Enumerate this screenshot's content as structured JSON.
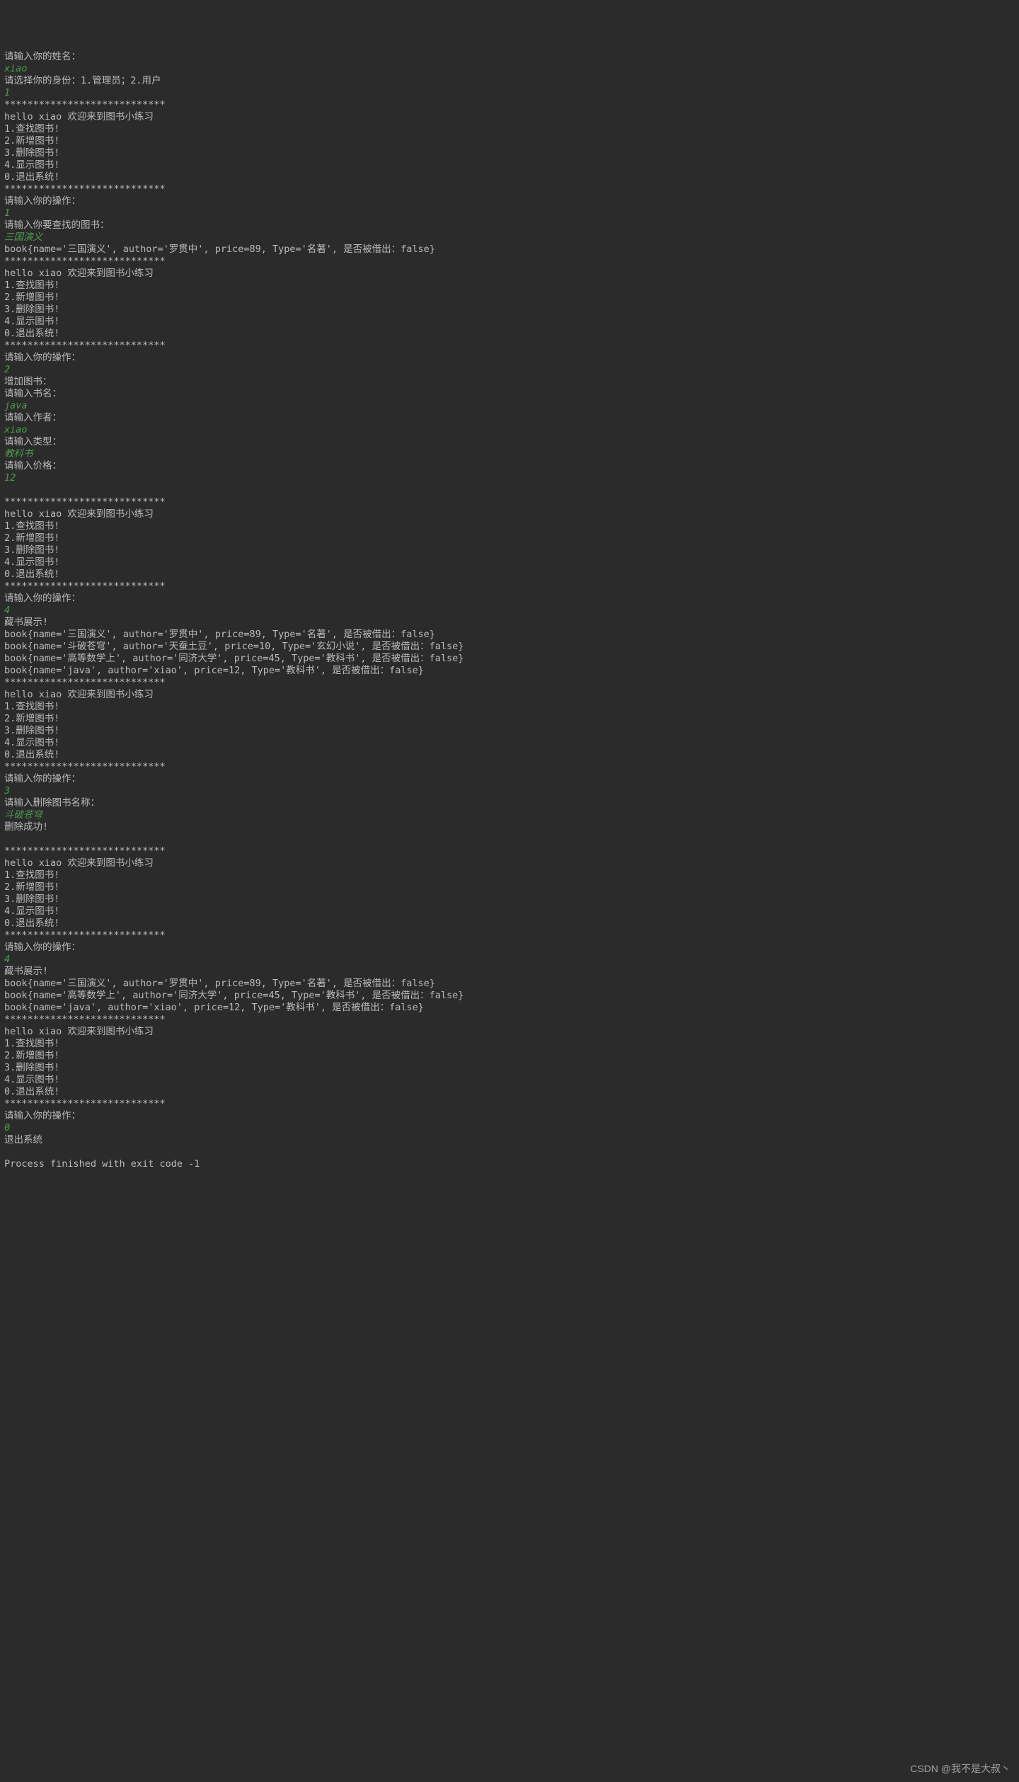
{
  "watermark": "CSDN @我不是大叔丶",
  "lines": [
    {
      "type": "out",
      "text": "请输入你的姓名："
    },
    {
      "type": "in",
      "text": "xiao"
    },
    {
      "type": "out",
      "text": "请选择你的身份：1.管理员；2.用户"
    },
    {
      "type": "in",
      "text": "1"
    },
    {
      "type": "out",
      "text": "****************************"
    },
    {
      "type": "out",
      "text": "hello xiao 欢迎来到图书小练习"
    },
    {
      "type": "out",
      "text": "1.查找图书!"
    },
    {
      "type": "out",
      "text": "2.新增图书!"
    },
    {
      "type": "out",
      "text": "3.删除图书!"
    },
    {
      "type": "out",
      "text": "4.显示图书!"
    },
    {
      "type": "out",
      "text": "0.退出系统!"
    },
    {
      "type": "out",
      "text": "****************************"
    },
    {
      "type": "out",
      "text": "请输入你的操作："
    },
    {
      "type": "in",
      "text": "1"
    },
    {
      "type": "out",
      "text": "请输入你要查找的图书："
    },
    {
      "type": "in",
      "text": "三国演义"
    },
    {
      "type": "out",
      "text": "book{name='三国演义', author='罗贯中', price=89, Type='名著', 是否被借出：false}"
    },
    {
      "type": "out",
      "text": "****************************"
    },
    {
      "type": "out",
      "text": "hello xiao 欢迎来到图书小练习"
    },
    {
      "type": "out",
      "text": "1.查找图书!"
    },
    {
      "type": "out",
      "text": "2.新增图书!"
    },
    {
      "type": "out",
      "text": "3.删除图书!"
    },
    {
      "type": "out",
      "text": "4.显示图书!"
    },
    {
      "type": "out",
      "text": "0.退出系统!"
    },
    {
      "type": "out",
      "text": "****************************"
    },
    {
      "type": "out",
      "text": "请输入你的操作："
    },
    {
      "type": "in",
      "text": "2"
    },
    {
      "type": "out",
      "text": "增加图书："
    },
    {
      "type": "out",
      "text": "请输入书名："
    },
    {
      "type": "in",
      "text": "java"
    },
    {
      "type": "out",
      "text": "请输入作者："
    },
    {
      "type": "in",
      "text": "xiao"
    },
    {
      "type": "out",
      "text": "请输入类型："
    },
    {
      "type": "in",
      "text": "教科书"
    },
    {
      "type": "out",
      "text": "请输入价格："
    },
    {
      "type": "in",
      "text": "12"
    },
    {
      "type": "out",
      "text": ""
    },
    {
      "type": "out",
      "text": "****************************"
    },
    {
      "type": "out",
      "text": "hello xiao 欢迎来到图书小练习"
    },
    {
      "type": "out",
      "text": "1.查找图书!"
    },
    {
      "type": "out",
      "text": "2.新增图书!"
    },
    {
      "type": "out",
      "text": "3.删除图书!"
    },
    {
      "type": "out",
      "text": "4.显示图书!"
    },
    {
      "type": "out",
      "text": "0.退出系统!"
    },
    {
      "type": "out",
      "text": "****************************"
    },
    {
      "type": "out",
      "text": "请输入你的操作："
    },
    {
      "type": "in",
      "text": "4"
    },
    {
      "type": "out",
      "text": "藏书展示!"
    },
    {
      "type": "out",
      "text": "book{name='三国演义', author='罗贯中', price=89, Type='名著', 是否被借出：false}"
    },
    {
      "type": "out",
      "text": "book{name='斗破苍穹', author='天蚕土豆', price=10, Type='玄幻小说', 是否被借出：false}"
    },
    {
      "type": "out",
      "text": "book{name='高等数学上', author='同济大学', price=45, Type='教科书', 是否被借出：false}"
    },
    {
      "type": "out",
      "text": "book{name='java', author='xiao', price=12, Type='教科书', 是否被借出：false}"
    },
    {
      "type": "out",
      "text": "****************************"
    },
    {
      "type": "out",
      "text": "hello xiao 欢迎来到图书小练习"
    },
    {
      "type": "out",
      "text": "1.查找图书!"
    },
    {
      "type": "out",
      "text": "2.新增图书!"
    },
    {
      "type": "out",
      "text": "3.删除图书!"
    },
    {
      "type": "out",
      "text": "4.显示图书!"
    },
    {
      "type": "out",
      "text": "0.退出系统!"
    },
    {
      "type": "out",
      "text": "****************************"
    },
    {
      "type": "out",
      "text": "请输入你的操作："
    },
    {
      "type": "in",
      "text": "3"
    },
    {
      "type": "out",
      "text": "请输入删除图书名称："
    },
    {
      "type": "in",
      "text": "斗破苍穹"
    },
    {
      "type": "out",
      "text": "删除成功!"
    },
    {
      "type": "out",
      "text": ""
    },
    {
      "type": "out",
      "text": "****************************"
    },
    {
      "type": "out",
      "text": "hello xiao 欢迎来到图书小练习"
    },
    {
      "type": "out",
      "text": "1.查找图书!"
    },
    {
      "type": "out",
      "text": "2.新增图书!"
    },
    {
      "type": "out",
      "text": "3.删除图书!"
    },
    {
      "type": "out",
      "text": "4.显示图书!"
    },
    {
      "type": "out",
      "text": "0.退出系统!"
    },
    {
      "type": "out",
      "text": "****************************"
    },
    {
      "type": "out",
      "text": "请输入你的操作："
    },
    {
      "type": "in",
      "text": "4"
    },
    {
      "type": "out",
      "text": "藏书展示!"
    },
    {
      "type": "out",
      "text": "book{name='三国演义', author='罗贯中', price=89, Type='名著', 是否被借出：false}"
    },
    {
      "type": "out",
      "text": "book{name='高等数学上', author='同济大学', price=45, Type='教科书', 是否被借出：false}"
    },
    {
      "type": "out",
      "text": "book{name='java', author='xiao', price=12, Type='教科书', 是否被借出：false}"
    },
    {
      "type": "out",
      "text": "****************************"
    },
    {
      "type": "out",
      "text": "hello xiao 欢迎来到图书小练习"
    },
    {
      "type": "out",
      "text": "1.查找图书!"
    },
    {
      "type": "out",
      "text": "2.新增图书!"
    },
    {
      "type": "out",
      "text": "3.删除图书!"
    },
    {
      "type": "out",
      "text": "4.显示图书!"
    },
    {
      "type": "out",
      "text": "0.退出系统!"
    },
    {
      "type": "out",
      "text": "****************************"
    },
    {
      "type": "out",
      "text": "请输入你的操作："
    },
    {
      "type": "in",
      "text": "0"
    },
    {
      "type": "out",
      "text": "退出系统"
    },
    {
      "type": "out",
      "text": ""
    },
    {
      "type": "out",
      "text": "Process finished with exit code -1"
    }
  ]
}
